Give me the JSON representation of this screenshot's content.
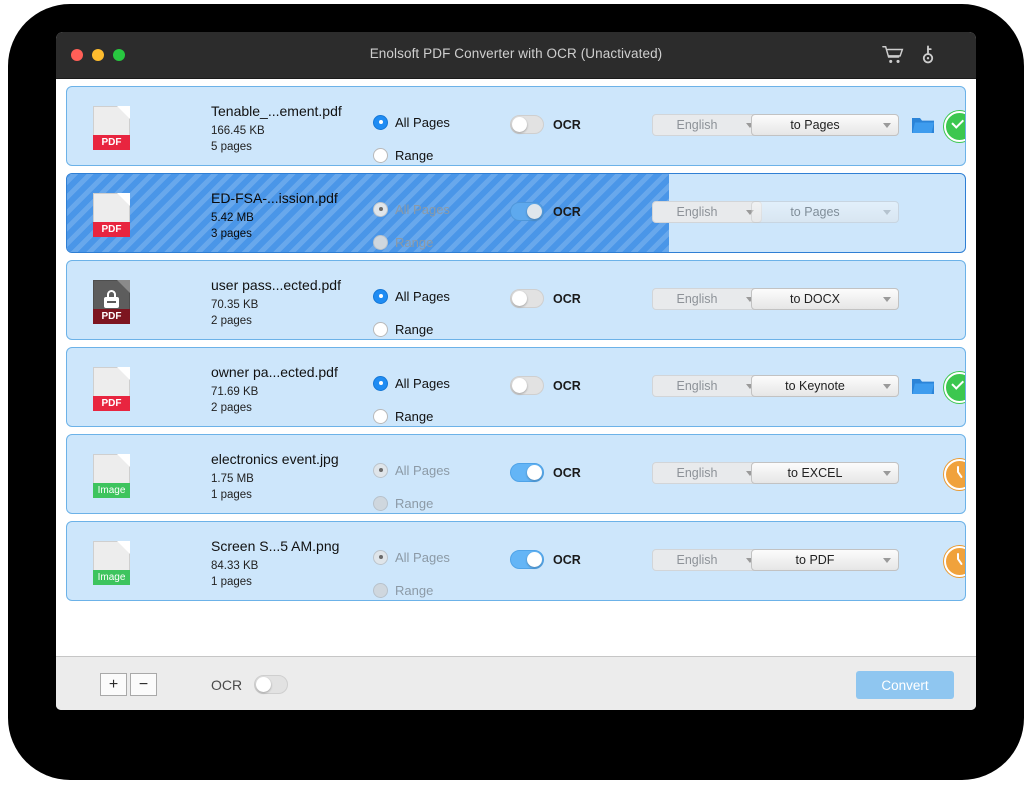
{
  "window": {
    "title": "Enolsoft PDF Converter with OCR (Unactivated)",
    "traffic": {
      "close": "close",
      "minimize": "minimize",
      "maximize": "maximize"
    },
    "toolbar_icons": {
      "cart": "shopping-cart-icon",
      "key": "key-icon"
    }
  },
  "labels": {
    "all_pages": "All Pages",
    "range": "Range",
    "ocr": "OCR"
  },
  "colors": {
    "row_background": "#cde6fb",
    "row_border": "#6cb2e8",
    "selected_fill": "#4a96e8",
    "accent_blue": "#1f8cf3",
    "pdf_badge": "#e8253f",
    "pdf_locked_badge": "#7d1520",
    "image_badge": "#3ec45e",
    "status_done": "#3cc74f",
    "status_waiting": "#f0a23c",
    "convert_button": "#8fc6f0",
    "titlebar": "#2c2c2c"
  },
  "files": [
    {
      "name": "Tenable_...ement.pdf",
      "size": "166.45 KB",
      "pages": "5 pages",
      "kind": "pdf",
      "badge": "PDF",
      "locked": false,
      "selected": false,
      "disabled": false,
      "all_pages_selected": true,
      "range_selected": false,
      "ocr_on": false,
      "language": "English",
      "format": "to Pages",
      "has_folder": true,
      "status": "done",
      "progress": 0
    },
    {
      "name": "ED-FSA-...ission.pdf",
      "size": "5.42 MB",
      "pages": "3 pages",
      "kind": "pdf",
      "badge": "PDF",
      "locked": false,
      "selected": true,
      "disabled": true,
      "all_pages_selected": true,
      "range_selected": false,
      "ocr_on": false,
      "language": "English",
      "format": "to Pages",
      "has_folder": false,
      "status": "none",
      "progress": 67
    },
    {
      "name": "user pass...ected.pdf",
      "size": "70.35 KB",
      "pages": "2 pages",
      "kind": "pdf",
      "badge": "PDF",
      "locked": true,
      "selected": false,
      "disabled": false,
      "all_pages_selected": true,
      "range_selected": false,
      "ocr_on": false,
      "language": "English",
      "format": "to DOCX",
      "has_folder": false,
      "status": "none",
      "progress": 0
    },
    {
      "name": "owner pa...ected.pdf",
      "size": "71.69 KB",
      "pages": "2 pages",
      "kind": "pdf",
      "badge": "PDF",
      "locked": false,
      "selected": false,
      "disabled": false,
      "all_pages_selected": true,
      "range_selected": false,
      "ocr_on": false,
      "language": "English",
      "format": "to Keynote",
      "has_folder": true,
      "status": "done",
      "progress": 0
    },
    {
      "name": "electronics event.jpg",
      "size": "1.75 MB",
      "pages": "1 pages",
      "kind": "image",
      "badge": "Image",
      "locked": false,
      "selected": false,
      "disabled": true,
      "all_pages_selected": true,
      "range_selected": false,
      "ocr_on": true,
      "language": "English",
      "format": "to EXCEL",
      "has_folder": false,
      "status": "waiting",
      "progress": 0
    },
    {
      "name": "Screen S...5 AM.png",
      "size": "84.33 KB",
      "pages": "1 pages",
      "kind": "image",
      "badge": "Image",
      "locked": false,
      "selected": false,
      "disabled": true,
      "all_pages_selected": true,
      "range_selected": false,
      "ocr_on": true,
      "language": "English",
      "format": "to PDF",
      "has_folder": false,
      "status": "waiting",
      "progress": 0
    }
  ],
  "bottom": {
    "add_label": "+",
    "remove_label": "−",
    "ocr_label": "OCR",
    "ocr_on": false,
    "convert_label": "Convert"
  }
}
